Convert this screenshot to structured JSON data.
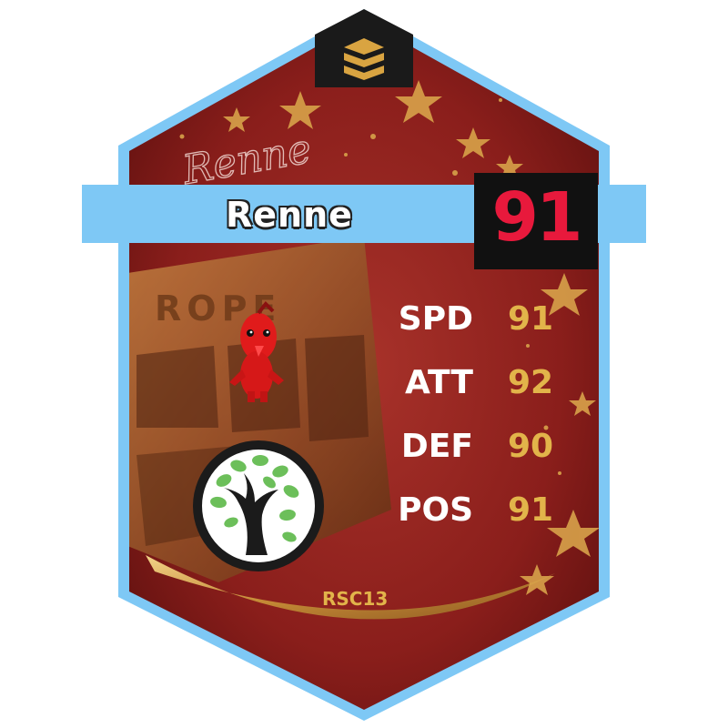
{
  "card": {
    "player_name": "Renne",
    "signature_text": "Renne",
    "overall": "91",
    "code": "RSC13",
    "team_watermark_text": "ROPE",
    "stats": [
      {
        "label": "SPD",
        "value": "91"
      },
      {
        "label": "ATT",
        "value": "92"
      },
      {
        "label": "DEF",
        "value": "90"
      },
      {
        "label": "POS",
        "value": "91"
      }
    ],
    "colors": {
      "frame": "#7ec8f5",
      "background": "#8e1f1c",
      "gold": "#e2b44a",
      "overall": "#e8193c"
    },
    "icons": [
      "brand-logo-icon",
      "red-pikmin-figure",
      "tree-logo-icon",
      "star-decoration"
    ]
  }
}
